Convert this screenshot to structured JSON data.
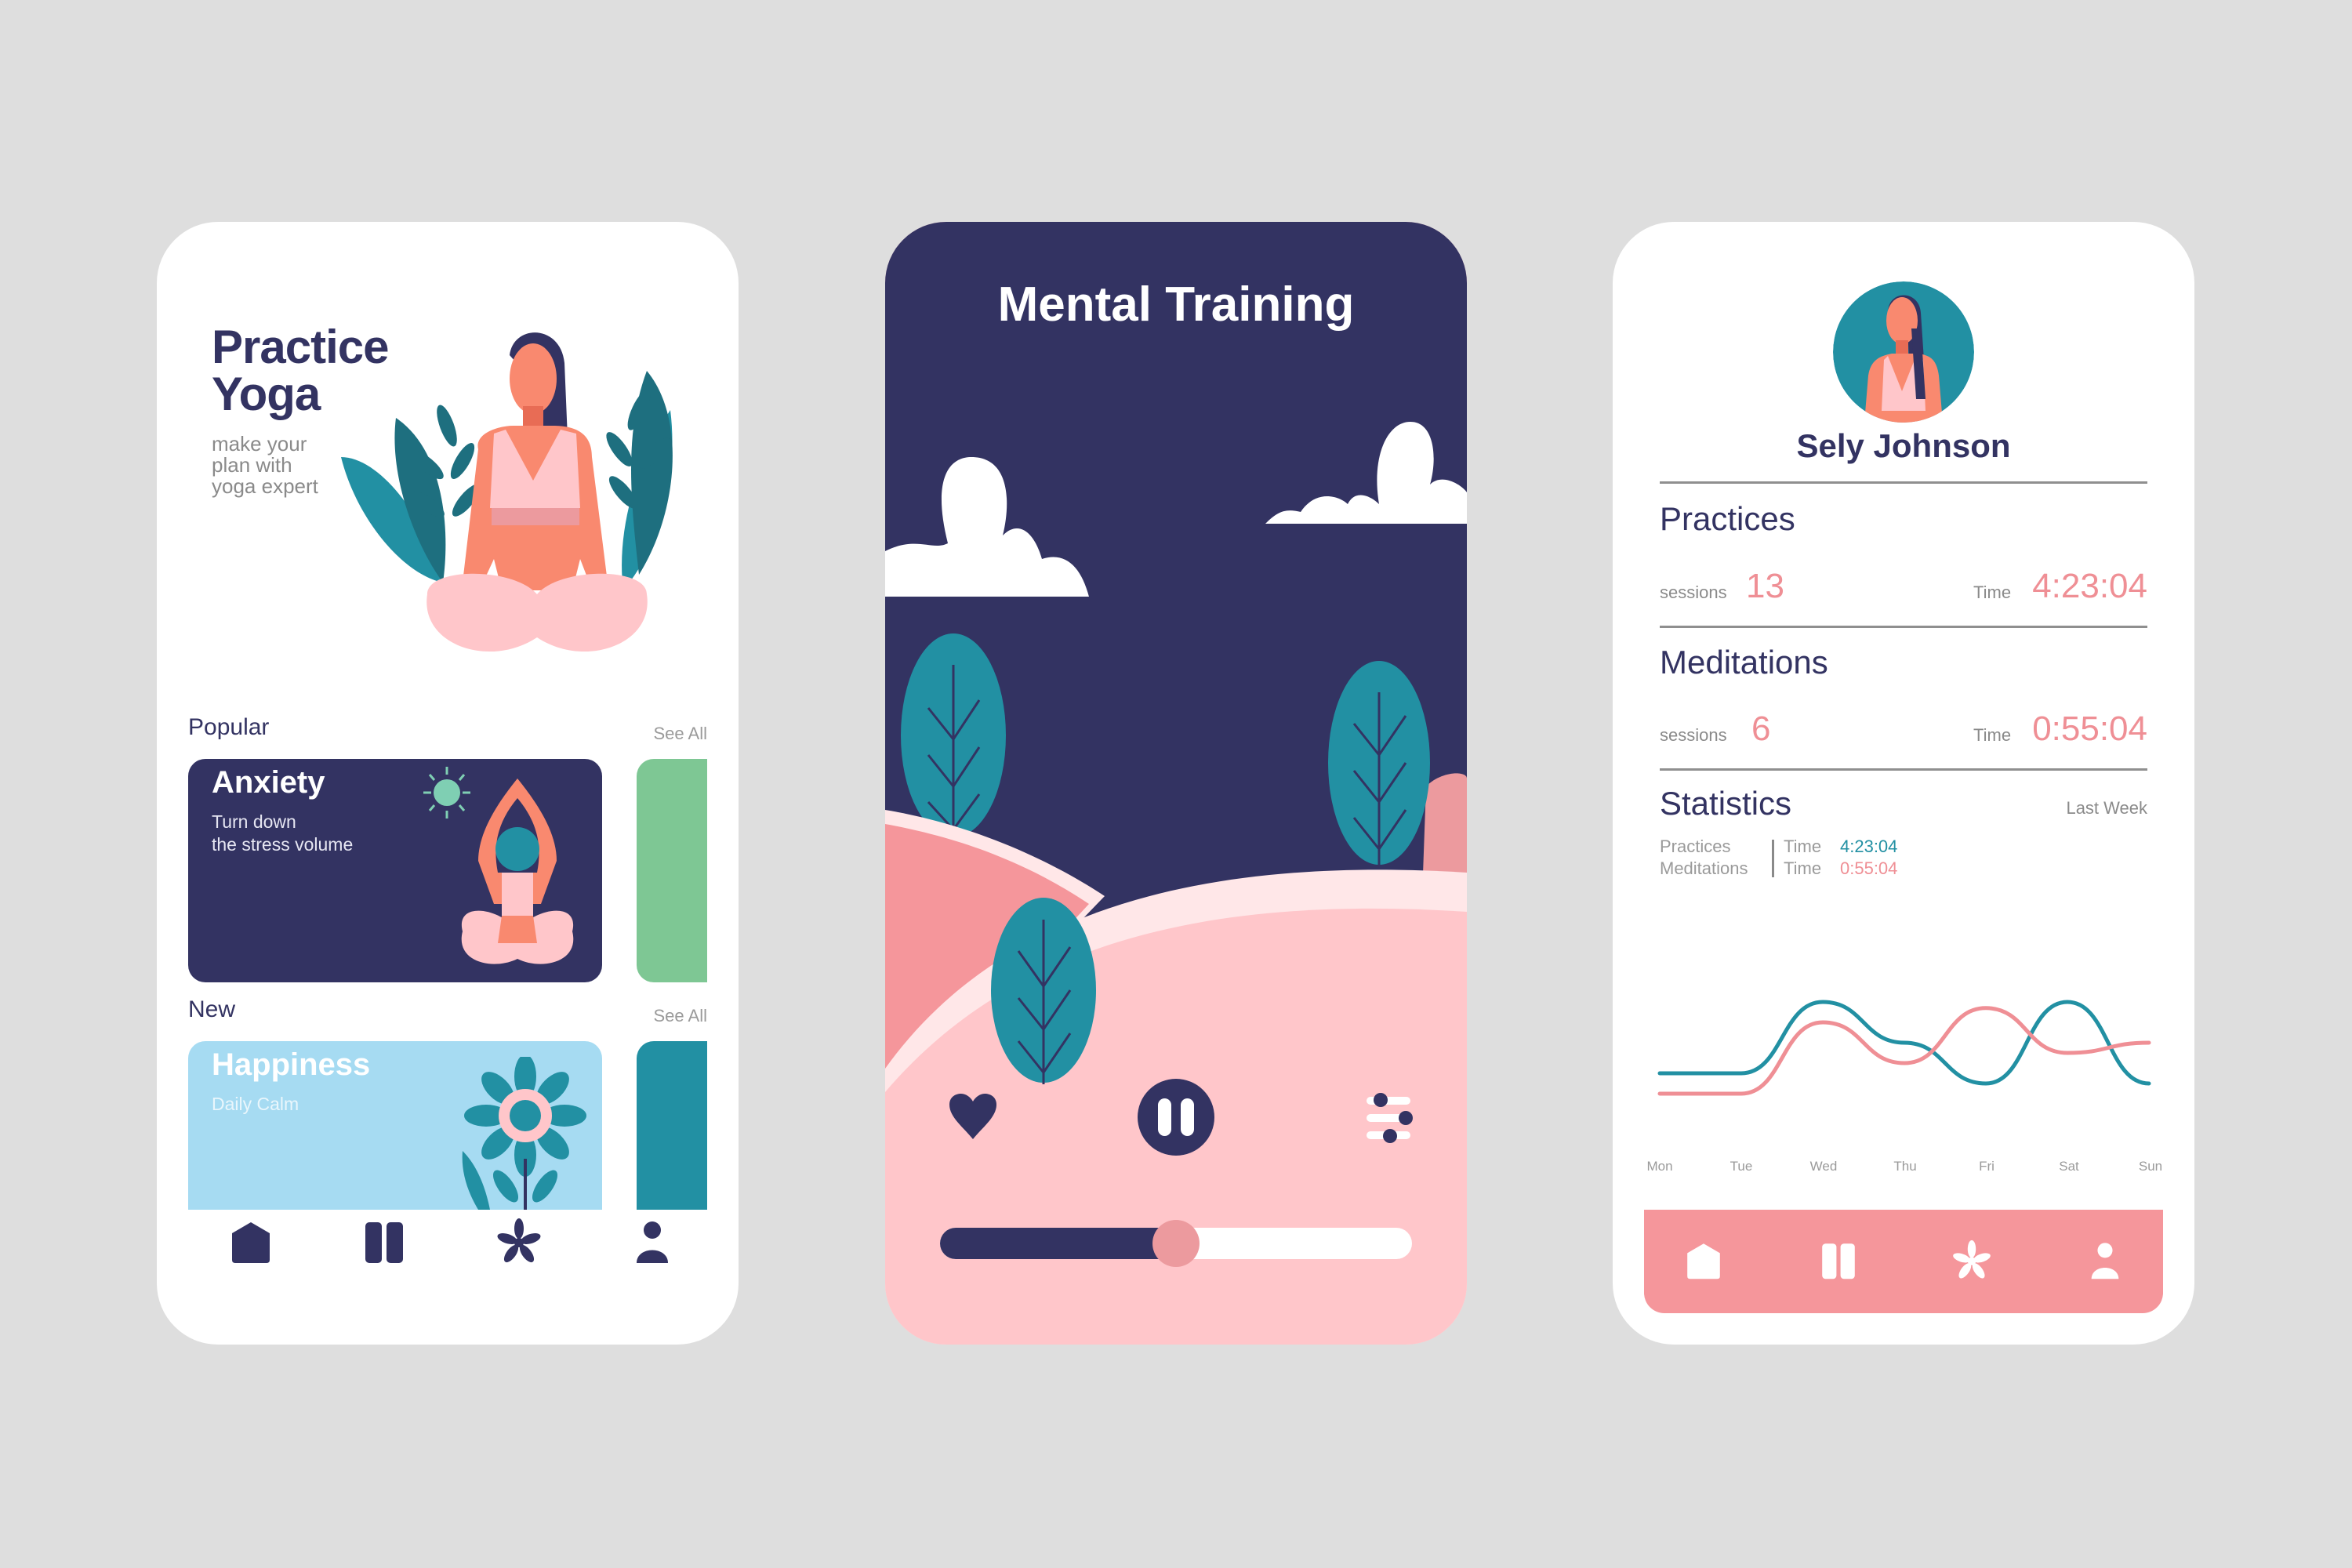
{
  "colors": {
    "navy": "#333362",
    "teal": "#2290a3",
    "green": "#7ec794",
    "light_blue": "#a6dbf2",
    "pink": "#ffc6ca",
    "coral": "#f5969b",
    "salmon": "#f9896f",
    "background": "#dedede"
  },
  "practice_screen": {
    "title_line1": "Practice",
    "title_line2": "Yoga",
    "subtitle_lines": [
      "make your",
      "plan with",
      "yoga expert"
    ],
    "popular": {
      "label": "Popular",
      "see_all": "See All",
      "card": {
        "title": "Anxiety",
        "subtitle_line1": "Turn down",
        "subtitle_line2": "the stress volume"
      }
    },
    "new": {
      "label": "New",
      "see_all": "See All",
      "card": {
        "title": "Happiness",
        "subtitle": "Daily Calm"
      }
    },
    "nav": [
      "home-icon",
      "pause-icon",
      "flower-icon",
      "user-icon"
    ]
  },
  "player_screen": {
    "title": "Mental Training",
    "controls": [
      "heart-icon",
      "pause-icon",
      "settings-sliders-icon"
    ],
    "progress": 0.5
  },
  "profile_screen": {
    "name": "Sely Johnson",
    "practices": {
      "heading": "Practices",
      "sessions_label": "sessions",
      "sessions": "13",
      "time_label": "Time",
      "time": "4:23:04"
    },
    "meditations": {
      "heading": "Meditations",
      "sessions_label": "sessions",
      "sessions": "6",
      "time_label": "Time",
      "time": "0:55:04"
    },
    "statistics": {
      "heading": "Statistics",
      "period": "Last Week",
      "legend": [
        {
          "name": "Practices",
          "time_label": "Time",
          "time": "4:23:04",
          "color": "#2290a3"
        },
        {
          "name": "Meditations",
          "time_label": "Time",
          "time": "0:55:04",
          "color": "#ef8f95"
        }
      ]
    },
    "nav": [
      "home-icon",
      "pause-icon",
      "flower-icon",
      "user-icon"
    ]
  },
  "chart_data": {
    "type": "line",
    "title": "Statistics",
    "categories": [
      "Mon",
      "Tue",
      "Wed",
      "Thu",
      "Fri",
      "Sat",
      "Sun"
    ],
    "series": [
      {
        "name": "Practices",
        "color": "#2290a3",
        "values": [
          40,
          40,
          75,
          55,
          35,
          75,
          35
        ]
      },
      {
        "name": "Meditations",
        "color": "#ef8f95",
        "values": [
          30,
          30,
          65,
          45,
          72,
          50,
          55
        ]
      }
    ],
    "ylim": [
      0,
      100
    ],
    "grid": false,
    "legend": "top-left"
  }
}
